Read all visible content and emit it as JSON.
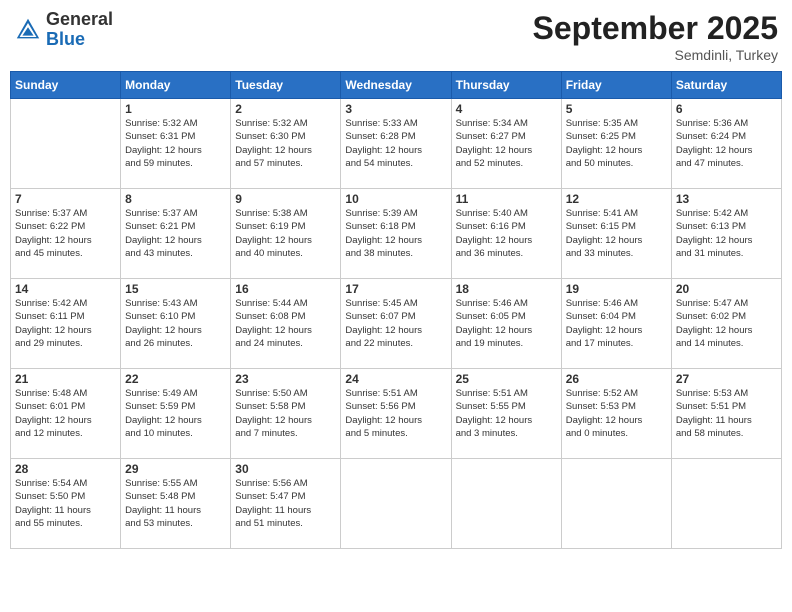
{
  "header": {
    "logo_general": "General",
    "logo_blue": "Blue",
    "month": "September 2025",
    "location": "Semdinli, Turkey"
  },
  "weekdays": [
    "Sunday",
    "Monday",
    "Tuesday",
    "Wednesday",
    "Thursday",
    "Friday",
    "Saturday"
  ],
  "weeks": [
    [
      {
        "day": "",
        "info": ""
      },
      {
        "day": "1",
        "info": "Sunrise: 5:32 AM\nSunset: 6:31 PM\nDaylight: 12 hours\nand 59 minutes."
      },
      {
        "day": "2",
        "info": "Sunrise: 5:32 AM\nSunset: 6:30 PM\nDaylight: 12 hours\nand 57 minutes."
      },
      {
        "day": "3",
        "info": "Sunrise: 5:33 AM\nSunset: 6:28 PM\nDaylight: 12 hours\nand 54 minutes."
      },
      {
        "day": "4",
        "info": "Sunrise: 5:34 AM\nSunset: 6:27 PM\nDaylight: 12 hours\nand 52 minutes."
      },
      {
        "day": "5",
        "info": "Sunrise: 5:35 AM\nSunset: 6:25 PM\nDaylight: 12 hours\nand 50 minutes."
      },
      {
        "day": "6",
        "info": "Sunrise: 5:36 AM\nSunset: 6:24 PM\nDaylight: 12 hours\nand 47 minutes."
      }
    ],
    [
      {
        "day": "7",
        "info": "Sunrise: 5:37 AM\nSunset: 6:22 PM\nDaylight: 12 hours\nand 45 minutes."
      },
      {
        "day": "8",
        "info": "Sunrise: 5:37 AM\nSunset: 6:21 PM\nDaylight: 12 hours\nand 43 minutes."
      },
      {
        "day": "9",
        "info": "Sunrise: 5:38 AM\nSunset: 6:19 PM\nDaylight: 12 hours\nand 40 minutes."
      },
      {
        "day": "10",
        "info": "Sunrise: 5:39 AM\nSunset: 6:18 PM\nDaylight: 12 hours\nand 38 minutes."
      },
      {
        "day": "11",
        "info": "Sunrise: 5:40 AM\nSunset: 6:16 PM\nDaylight: 12 hours\nand 36 minutes."
      },
      {
        "day": "12",
        "info": "Sunrise: 5:41 AM\nSunset: 6:15 PM\nDaylight: 12 hours\nand 33 minutes."
      },
      {
        "day": "13",
        "info": "Sunrise: 5:42 AM\nSunset: 6:13 PM\nDaylight: 12 hours\nand 31 minutes."
      }
    ],
    [
      {
        "day": "14",
        "info": "Sunrise: 5:42 AM\nSunset: 6:11 PM\nDaylight: 12 hours\nand 29 minutes."
      },
      {
        "day": "15",
        "info": "Sunrise: 5:43 AM\nSunset: 6:10 PM\nDaylight: 12 hours\nand 26 minutes."
      },
      {
        "day": "16",
        "info": "Sunrise: 5:44 AM\nSunset: 6:08 PM\nDaylight: 12 hours\nand 24 minutes."
      },
      {
        "day": "17",
        "info": "Sunrise: 5:45 AM\nSunset: 6:07 PM\nDaylight: 12 hours\nand 22 minutes."
      },
      {
        "day": "18",
        "info": "Sunrise: 5:46 AM\nSunset: 6:05 PM\nDaylight: 12 hours\nand 19 minutes."
      },
      {
        "day": "19",
        "info": "Sunrise: 5:46 AM\nSunset: 6:04 PM\nDaylight: 12 hours\nand 17 minutes."
      },
      {
        "day": "20",
        "info": "Sunrise: 5:47 AM\nSunset: 6:02 PM\nDaylight: 12 hours\nand 14 minutes."
      }
    ],
    [
      {
        "day": "21",
        "info": "Sunrise: 5:48 AM\nSunset: 6:01 PM\nDaylight: 12 hours\nand 12 minutes."
      },
      {
        "day": "22",
        "info": "Sunrise: 5:49 AM\nSunset: 5:59 PM\nDaylight: 12 hours\nand 10 minutes."
      },
      {
        "day": "23",
        "info": "Sunrise: 5:50 AM\nSunset: 5:58 PM\nDaylight: 12 hours\nand 7 minutes."
      },
      {
        "day": "24",
        "info": "Sunrise: 5:51 AM\nSunset: 5:56 PM\nDaylight: 12 hours\nand 5 minutes."
      },
      {
        "day": "25",
        "info": "Sunrise: 5:51 AM\nSunset: 5:55 PM\nDaylight: 12 hours\nand 3 minutes."
      },
      {
        "day": "26",
        "info": "Sunrise: 5:52 AM\nSunset: 5:53 PM\nDaylight: 12 hours\nand 0 minutes."
      },
      {
        "day": "27",
        "info": "Sunrise: 5:53 AM\nSunset: 5:51 PM\nDaylight: 11 hours\nand 58 minutes."
      }
    ],
    [
      {
        "day": "28",
        "info": "Sunrise: 5:54 AM\nSunset: 5:50 PM\nDaylight: 11 hours\nand 55 minutes."
      },
      {
        "day": "29",
        "info": "Sunrise: 5:55 AM\nSunset: 5:48 PM\nDaylight: 11 hours\nand 53 minutes."
      },
      {
        "day": "30",
        "info": "Sunrise: 5:56 AM\nSunset: 5:47 PM\nDaylight: 11 hours\nand 51 minutes."
      },
      {
        "day": "",
        "info": ""
      },
      {
        "day": "",
        "info": ""
      },
      {
        "day": "",
        "info": ""
      },
      {
        "day": "",
        "info": ""
      }
    ]
  ]
}
